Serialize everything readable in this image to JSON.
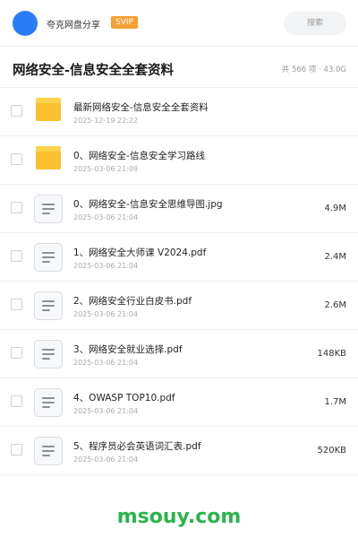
{
  "header": {
    "brand": "夸克网盘分享",
    "badge": "SVIP",
    "search_placeholder": "搜索",
    "accent_color": "#2b7cf6",
    "badge_color": "#f5a035"
  },
  "folder": {
    "title": "网络安全-信息安全全套资料",
    "meta": "共 566 项 · 43.0G"
  },
  "files": [
    {
      "type": "folder-icon",
      "name": "最新网络安全-信息安全全套资料",
      "date": "2025-12-19 22:22",
      "size": ""
    },
    {
      "type": "folder-icon",
      "name": "0、网络安全-信息安全学习路线",
      "date": "2025-03-06 21:09",
      "size": ""
    },
    {
      "type": "file-icon",
      "name": "0、网络安全-信息安全思维导图.jpg",
      "date": "2025-03-06 21:04",
      "size": "4.9M"
    },
    {
      "type": "file-icon",
      "name": "1、网络安全大师课 V2024.pdf",
      "date": "2025-03-06 21:04",
      "size": "2.4M"
    },
    {
      "type": "file-icon",
      "name": "2、网络安全行业白皮书.pdf",
      "date": "2025-03-06 21:04",
      "size": "2.6M"
    },
    {
      "type": "file-icon",
      "name": "3、网络安全就业选择.pdf",
      "date": "2025-03-06 21:04",
      "size": "148KB"
    },
    {
      "type": "file-icon",
      "name": "4、OWASP TOP10.pdf",
      "date": "2025-03-06 21:04",
      "size": "1.7M"
    },
    {
      "type": "file-icon",
      "name": "5、程序员必会英语词汇表.pdf",
      "date": "2025-03-06 21:04",
      "size": "520KB"
    }
  ],
  "watermark": "msouy.com"
}
